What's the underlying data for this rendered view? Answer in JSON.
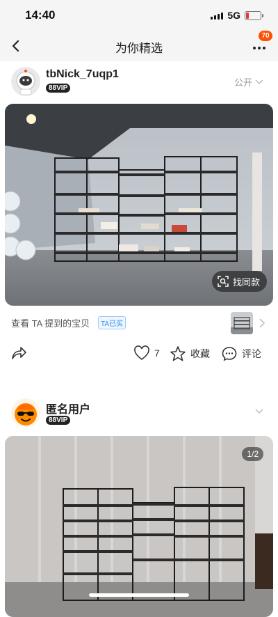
{
  "status_bar": {
    "time": "14:40",
    "network": "5G"
  },
  "nav": {
    "title": "为你精选",
    "badge_count": "70"
  },
  "posts": [
    {
      "username": "tbNick_7uqp1",
      "vip": "88VIP",
      "visibility": "公开",
      "find_similar": "找同款",
      "mention_text": "查看 TA 提到的宝贝",
      "mention_tag": "TA已买",
      "like_count": "7",
      "favorite_label": "收藏",
      "comment_label": "评论"
    },
    {
      "username": "匿名用户",
      "vip": "88VIP",
      "image_counter": "1/2"
    }
  ]
}
